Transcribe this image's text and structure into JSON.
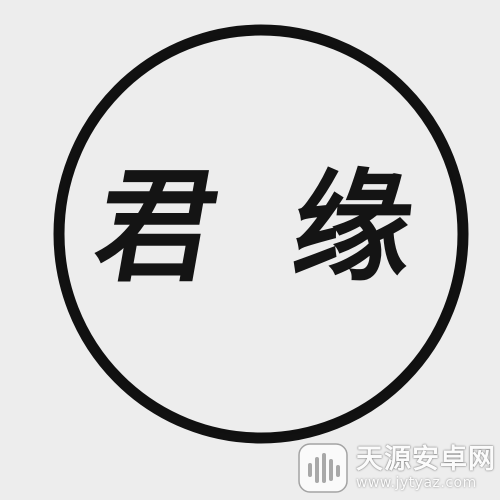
{
  "seal": {
    "left_char": "君",
    "right_char": "缘",
    "ring_color": "#111111",
    "ink_color": "#141414",
    "background": "#ededed"
  },
  "watermark": {
    "name": "天源安卓网",
    "url": "www.jytyaz.com",
    "logo_icon": "signal-bars-icon"
  }
}
